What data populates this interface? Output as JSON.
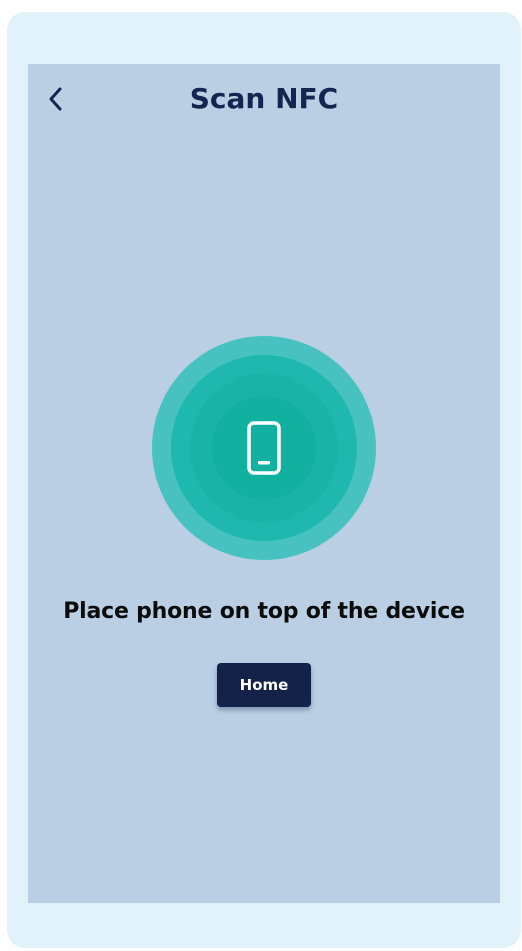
{
  "header": {
    "back_icon": "chevron-left-icon",
    "title": "Scan NFC"
  },
  "main": {
    "scan_icon": "smartphone-icon",
    "instruction": "Place phone on top of the device",
    "home_button_label": "Home"
  },
  "colors": {
    "frame_background": "#e1f2fa",
    "screen_background": "#bacfe3",
    "title_text": "#14254f",
    "ring_outer": "#47c2c0",
    "ring_inner": "#12b0a1",
    "button_background": "#14224a",
    "button_text": "#ffffff"
  }
}
